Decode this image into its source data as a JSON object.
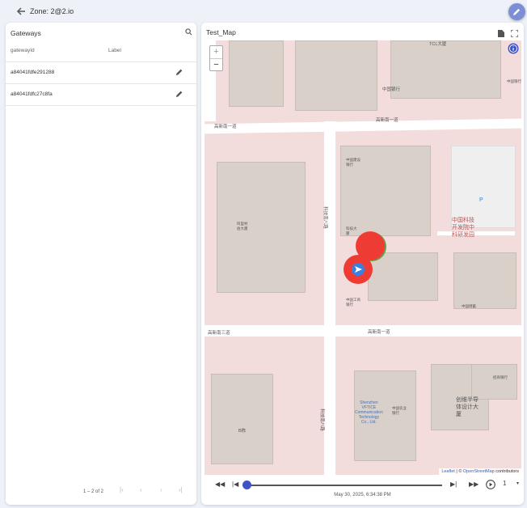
{
  "header": {
    "title": "Zone: 2@2.io"
  },
  "gateways": {
    "title": "Gateways",
    "columns": [
      "gatewayId",
      "Label"
    ],
    "rows": [
      {
        "id": "a84041fdfe291288",
        "label": ""
      },
      {
        "id": "a84041fdfc27c8fa",
        "label": ""
      }
    ],
    "pagination": "1 – 2 of 2"
  },
  "map": {
    "title": "Test_Map",
    "attribution_leaflet": "Leaflet",
    "attribution_sep": " | © ",
    "attribution_osm": "OpenStreetMap",
    "attribution_tail": " contributors",
    "labels": {
      "l1": "高新南一道",
      "l2": "高新南一道",
      "l3": "高新南三道",
      "l4": "高新南一道",
      "l5": "科技南八路",
      "l6": "科技南八路",
      "l7": "中国科技\n开发院中\n科研发园",
      "l8": "创维半导\n体设计大\n厦",
      "l9": "Shenzhen\nVFTICE\nCommunication\nTechnology\nCo., Ltd.",
      "l10": "TCL大厦",
      "l11": "中国银行",
      "l12": "中国建设\n银行",
      "l13": "中国工商\n银行",
      "l14": "中国农业\n银行",
      "l15": "招商银行",
      "l16": "中国银行",
      "l17": "中国储蓄",
      "l18": "B栋",
      "l19": "科技大\n厦",
      "l20": "阿里村\n伯大厦"
    },
    "parking": "P"
  },
  "playback": {
    "time": "May 30, 2025, 6:34:38 PM",
    "speed": "1"
  }
}
